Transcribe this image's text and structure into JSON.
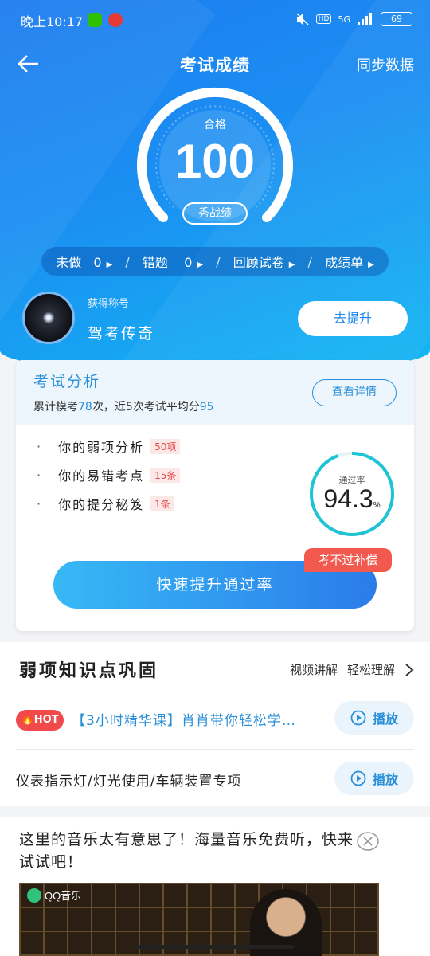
{
  "status_bar": {
    "time": "晚上10:17",
    "hd": "HD",
    "network": "5G",
    "battery": "69"
  },
  "header": {
    "title": "考试成绩",
    "sync_label": "同步数据"
  },
  "score": {
    "label": "合格",
    "value": "100",
    "show_button": "秀战绩"
  },
  "stats": [
    {
      "label": "未做",
      "value": "0"
    },
    {
      "label": "错题",
      "value": "0"
    },
    {
      "label": "回顾试卷",
      "value": ""
    },
    {
      "label": "成绩单",
      "value": ""
    }
  ],
  "title_badge": {
    "caption": "获得称号",
    "name": "驾考传奇",
    "button": "去提升"
  },
  "analysis": {
    "title": "考试分析",
    "summary_prefix": "累计模考",
    "exam_count": "78",
    "summary_middle": "次，近5次考试平均分",
    "avg_score": "95",
    "detail_button": "查看详情",
    "items": [
      {
        "label": "你的弱项分析",
        "tag": "50项"
      },
      {
        "label": "你的易错考点",
        "tag": "15条"
      },
      {
        "label": "你的提分秘笈",
        "tag": "1条"
      }
    ],
    "pass_rate_label": "通过率",
    "pass_rate": "94.3",
    "pass_rate_unit": "%",
    "pass_rate_fraction": 0.943,
    "compensate_label": "考不过补偿",
    "fast_button": "快速提升通过率"
  },
  "weak_section": {
    "title": "弱项知识点巩固",
    "link_video": "视频讲解",
    "link_easy": "轻松理解",
    "courses": [
      {
        "badge": "HOT",
        "text": "【3小时精华课】肖肖带你轻松学…",
        "play": "播放"
      },
      {
        "text": "仪表指示灯/灯光使用/车辆装置专项",
        "play": "播放"
      }
    ]
  },
  "ad": {
    "text": "这里的音乐太有意思了！海量音乐免费听，快来试试吧！",
    "brand": "QQ音乐"
  },
  "colors": {
    "primary": "#1b86ef",
    "accent_blue": "#2a8fd8",
    "ring": "#1fc3d6",
    "hot_red": "#f04a4a"
  }
}
